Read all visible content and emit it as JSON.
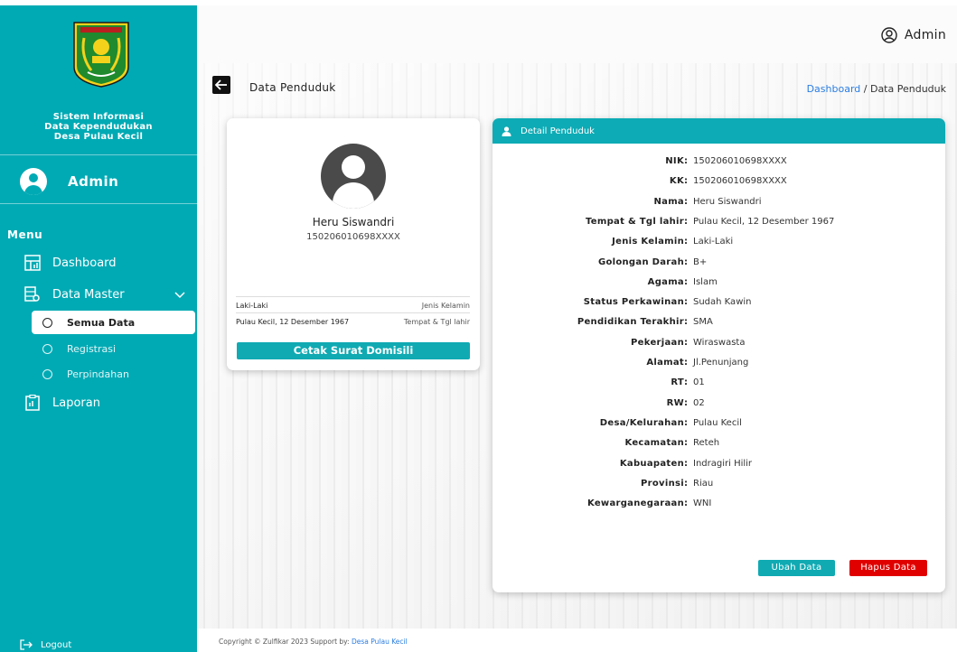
{
  "sidebar": {
    "title_line1": "Sistem Informasi",
    "title_line2": "Data Kependudukan",
    "title_line3": "Desa Pulau Kecil",
    "user_name": "Admin",
    "menu_label": "Menu",
    "items": {
      "dashboard": "Dashboard",
      "data_master": "Data Master",
      "semua_data": "Semua Data",
      "registrasi": "Registrasi",
      "perpindahan": "Perpindahan",
      "laporan": "Laporan"
    },
    "logout": "Logout"
  },
  "topbar": {
    "user_label": "Admin"
  },
  "header": {
    "page_title": "Data Penduduk",
    "breadcrumb_link": "Dashboard",
    "breadcrumb_sep": " / ",
    "breadcrumb_current": "Data Penduduk"
  },
  "profile": {
    "name": "Heru Siswandri",
    "nik": "150206010698XXXX",
    "rows": [
      {
        "value": "Laki-Laki",
        "label": "Jenis Kelamin"
      },
      {
        "value": "Pulau Kecil, 12 Desember 1967",
        "label": "Tempat & Tgl lahir"
      }
    ],
    "print_button": "Cetak Surat Domisili"
  },
  "detail": {
    "header": "Detail Penduduk",
    "fields": [
      {
        "key": "NIK",
        "value": "150206010698XXXX"
      },
      {
        "key": "KK",
        "value": "150206010698XXXX"
      },
      {
        "key": "Nama",
        "value": "Heru Siswandri"
      },
      {
        "key": "Tempat & Tgl lahir",
        "value": "Pulau Kecil, 12 Desember 1967"
      },
      {
        "key": "Jenis Kelamin",
        "value": "Laki-Laki"
      },
      {
        "key": "Golongan Darah",
        "value": "B+"
      },
      {
        "key": "Agama",
        "value": "Islam"
      },
      {
        "key": "Status Perkawinan",
        "value": "Sudah Kawin"
      },
      {
        "key": "Pendidikan Terakhir",
        "value": "SMA"
      },
      {
        "key": "Pekerjaan",
        "value": "Wiraswasta"
      },
      {
        "key": "Alamat",
        "value": "Jl.Penunjang"
      },
      {
        "key": "RT",
        "value": "01"
      },
      {
        "key": "RW",
        "value": "02"
      },
      {
        "key": "Desa/Kelurahan",
        "value": "Pulau Kecil"
      },
      {
        "key": "Kecamatan",
        "value": "Reteh"
      },
      {
        "key": "Kabuapaten",
        "value": "Indragiri Hilir"
      },
      {
        "key": "Provinsi",
        "value": "Riau"
      },
      {
        "key": "Kewarganegaraan",
        "value": "WNI"
      }
    ],
    "edit_button": "Ubah Data",
    "delete_button": "Hapus Data"
  },
  "footer": {
    "text": "Copyright © Zulfikar 2023 Support by: ",
    "link": "Desa Pulau Kecil"
  },
  "colors": {
    "primary": "#00aab4",
    "danger": "#e00000",
    "link": "#2a7de1"
  }
}
